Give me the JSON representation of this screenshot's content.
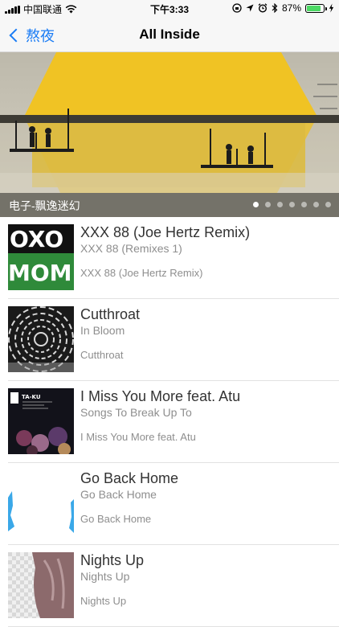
{
  "status_bar": {
    "carrier": "中国联通",
    "time": "下午3:33",
    "battery_percent": "87%",
    "battery_level": 0.87
  },
  "nav": {
    "back_label": "熬夜",
    "title": "All Inside"
  },
  "banner": {
    "caption": "电子-飘逸迷幻",
    "page_count": 7,
    "active_page": 0
  },
  "tracks": [
    {
      "title": "XXX 88 (Joe Hertz Remix)",
      "album": "XXX 88 (Remixes 1)",
      "subtitle": "XXX 88 (Joe Hertz Remix)"
    },
    {
      "title": "Cutthroat",
      "album": "In Bloom",
      "subtitle": "Cutthroat"
    },
    {
      "title": "I Miss You More feat. Atu",
      "album": "Songs To Break Up To",
      "subtitle": "I Miss You More feat. Atu",
      "art_label": "TA-KU"
    },
    {
      "title": "Go Back Home",
      "album": "Go Back Home",
      "subtitle": "Go Back Home"
    },
    {
      "title": "Nights Up",
      "album": "Nights Up",
      "subtitle": "Nights Up"
    }
  ]
}
